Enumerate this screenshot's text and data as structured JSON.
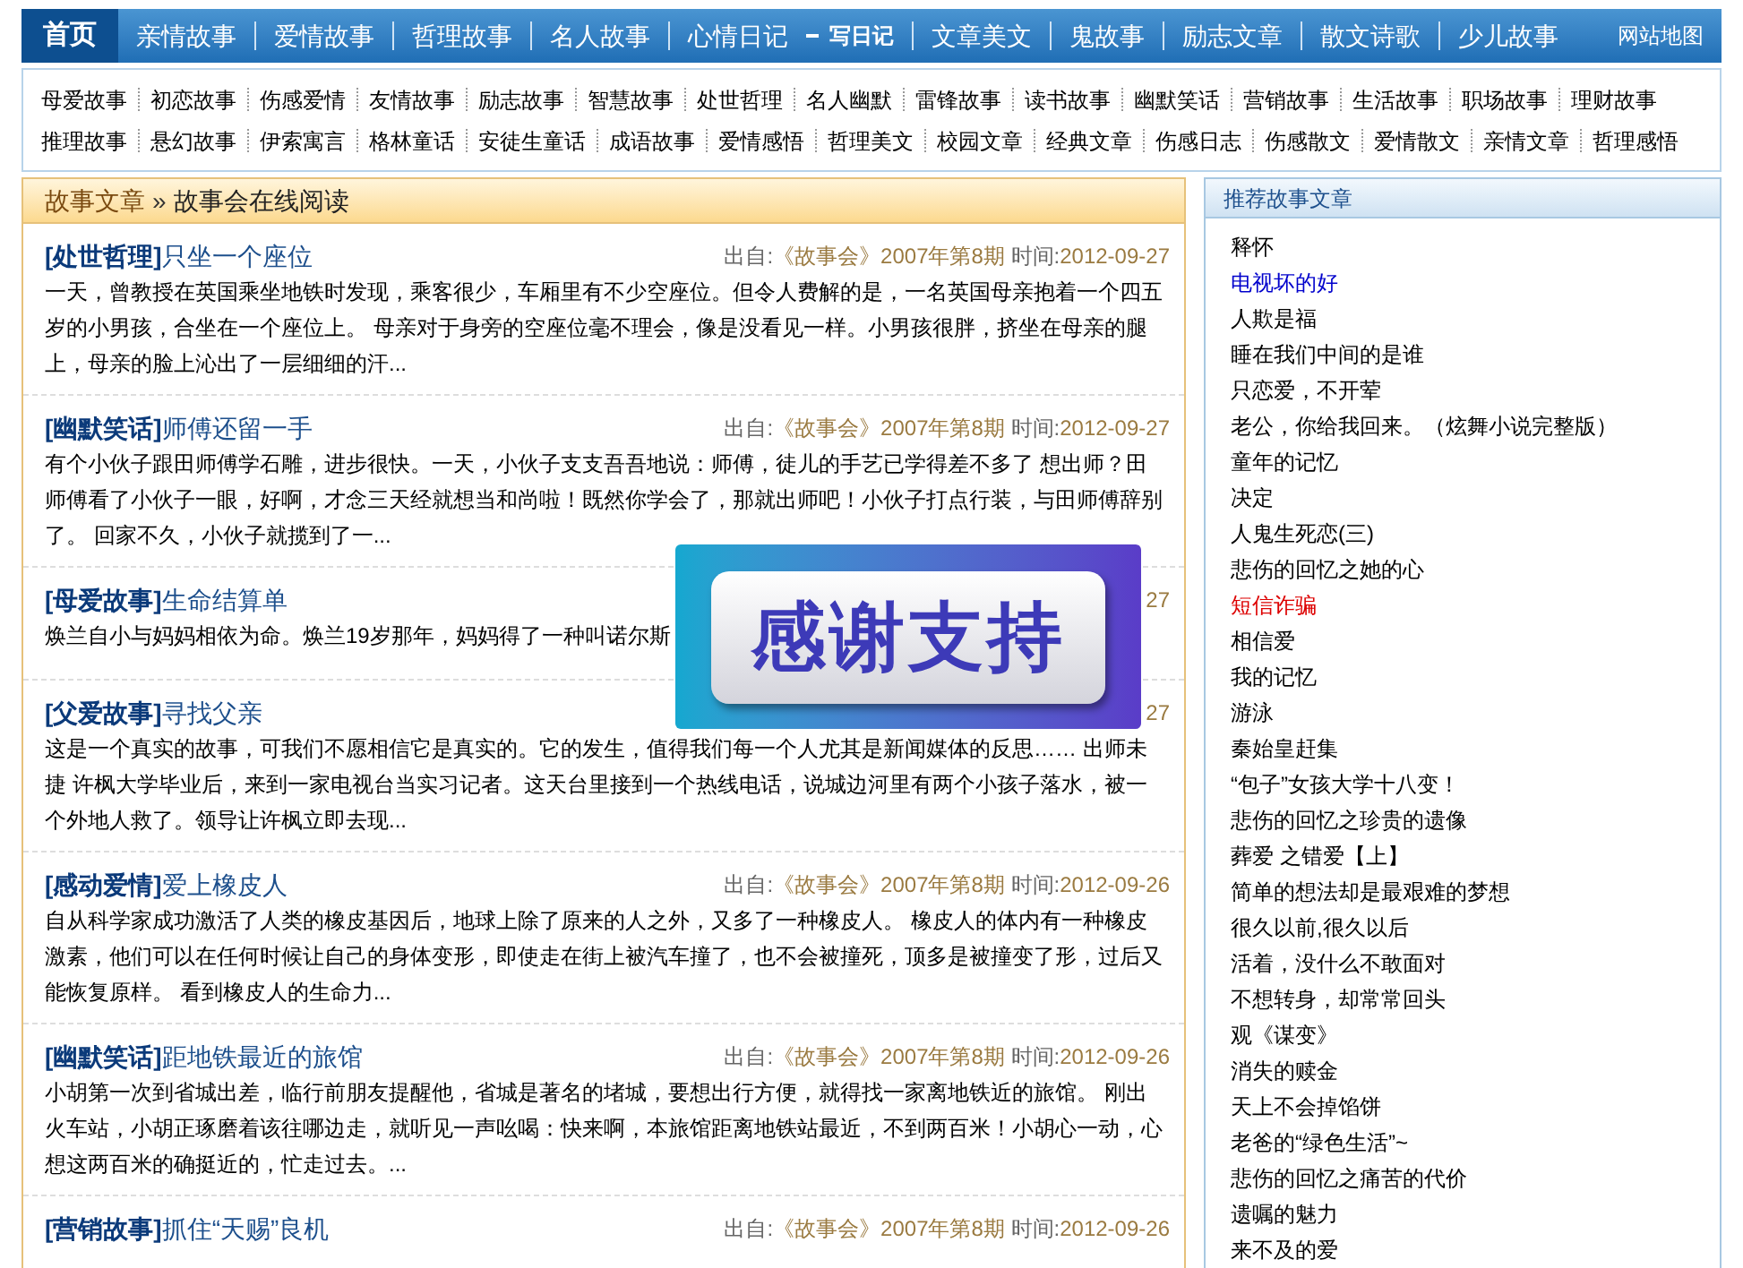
{
  "nav": {
    "items": [
      {
        "label": "首页",
        "selected": true
      },
      {
        "label": "亲情故事",
        "selected": false
      },
      {
        "label": "爱情故事",
        "selected": false
      },
      {
        "label": "哲理故事",
        "selected": false
      },
      {
        "label": "名人故事",
        "selected": false
      },
      {
        "label": "心情日记",
        "selected": false,
        "sub": "写日记"
      },
      {
        "label": "文章美文",
        "selected": false
      },
      {
        "label": "鬼故事",
        "selected": false
      },
      {
        "label": "励志文章",
        "selected": false
      },
      {
        "label": "散文诗歌",
        "selected": false
      },
      {
        "label": "少儿故事",
        "selected": false
      }
    ],
    "sitemap": "网站地图"
  },
  "subnav": [
    [
      "母爱故事",
      "初恋故事",
      "伤感爱情",
      "友情故事",
      "励志故事",
      "智慧故事",
      "处世哲理",
      "名人幽默",
      "雷锋故事",
      "读书故事",
      "幽默笑话",
      "营销故事",
      "生活故事",
      "职场故事",
      "理财故事"
    ],
    [
      "推理故事",
      "悬幻故事",
      "伊索寓言",
      "格林童话",
      "安徒生童话",
      "成语故事",
      "爱情感悟",
      "哲理美文",
      "校园文章",
      "经典文章",
      "伤感日志",
      "伤感散文",
      "爱情散文",
      "亲情文章",
      "哲理感悟"
    ]
  ],
  "breadcrumb": {
    "items": [
      "故事文章",
      "故事会在线阅读"
    ],
    "separator": "»"
  },
  "stories": [
    {
      "kind": "full",
      "category": "[处世哲理]",
      "title": "只坐一个座位",
      "source_label": "出自:",
      "source": "《故事会》2007年第8期",
      "time_label": "时间:",
      "time": "2012-09-27",
      "body": "一天，曾教授在英国乘坐地铁时发现，乘客很少，车厢里有不少空座位。但令人费解的是，一名英国母亲抱着一个四五岁的小男孩，合坐在一个座位上。 母亲对于身旁的空座位毫不理会，像是没看见一样。小男孩很胖，挤坐在母亲的腿上，母亲的脸上沁出了一层细细的汗..."
    },
    {
      "kind": "full",
      "category": "[幽默笑话]",
      "title": "师傅还留一手",
      "source_label": "出自:",
      "source": "《故事会》2007年第8期",
      "time_label": "时间:",
      "time": "2012-09-27",
      "body": "有个小伙子跟田师傅学石雕，进步很快。一天，小伙子支支吾吾地说：师傅，徒儿的手艺已学得差不多了 想出师？田师傅看了小伙子一眼，好啊，才念三天经就想当和尚啦！既然你学会了，那就出师吧！小伙子打点行装，与田师傅辞别了。 回家不久，小伙子就揽到了一..."
    },
    {
      "kind": "partial",
      "category": "[母爱故事]",
      "title": "生命结算单",
      "meta_fragment": "27",
      "body": "焕兰自小与妈妈相依为命。焕兰19岁那年，妈妈得了一种叫诺尔斯"
    },
    {
      "kind": "partial",
      "category": "[父爱故事]",
      "title": "寻找父亲",
      "meta_fragment": "27",
      "body": "这是一个真实的故事，可我们不愿相信它是真实的。它的发生，值得我们每一个人尤其是新闻媒体的反思…… 出师未捷 许枫大学毕业后，来到一家电视台当实习记者。这天台里接到一个热线电话，说城边河里有两个小孩子落水，被一个外地人救了。领导让许枫立即去现..."
    },
    {
      "kind": "full",
      "category": "[感动爱情]",
      "title": "爱上橡皮人",
      "source_label": "出自:",
      "source": "《故事会》2007年第8期",
      "time_label": "时间:",
      "time": "2012-09-26",
      "body": "自从科学家成功激活了人类的橡皮基因后，地球上除了原来的人之外，又多了一种橡皮人。 橡皮人的体内有一种橡皮激素，他们可以在任何时候让自己的身体变形，即使走在街上被汽车撞了，也不会被撞死，顶多是被撞变了形，过后又能恢复原样。 看到橡皮人的生命力..."
    },
    {
      "kind": "full",
      "category": "[幽默笑话]",
      "title": "距地铁最近的旅馆",
      "source_label": "出自:",
      "source": "《故事会》2007年第8期",
      "time_label": "时间:",
      "time": "2012-09-26",
      "body": "小胡第一次到省城出差，临行前朋友提醒他，省城是著名的堵城，要想出行方便，就得找一家离地铁近的旅馆。 刚出火车站，小胡正琢磨着该往哪边走，就听见一声吆喝：快来啊，本旅馆距离地铁站最近，不到两百米！小胡心一动，心想这两百米的确挺近的，忙走过去。..."
    },
    {
      "kind": "full",
      "category": "[营销故事]",
      "title": "抓住“天赐”良机",
      "source_label": "出自:",
      "source": "《故事会》2007年第8期",
      "time_label": "时间:",
      "time": "2012-09-26"
    }
  ],
  "overlay": {
    "text": "感谢支持"
  },
  "sidebar": {
    "title": "推荐故事文章",
    "items": [
      {
        "label": "释怀",
        "color": "#000000"
      },
      {
        "label": "电视坏的好",
        "color": "#0000cc"
      },
      {
        "label": "人欺是福",
        "color": "#000000"
      },
      {
        "label": "睡在我们中间的是谁",
        "color": "#000000"
      },
      {
        "label": "只恋爱，不开荤",
        "color": "#000000"
      },
      {
        "label": "老公，你给我回来。（炫舞小说完整版）",
        "color": "#000000"
      },
      {
        "label": "童年的记忆",
        "color": "#000000"
      },
      {
        "label": "决定",
        "color": "#000000"
      },
      {
        "label": "人鬼生死恋(三)",
        "color": "#000000"
      },
      {
        "label": "悲伤的回忆之她的心",
        "color": "#000000"
      },
      {
        "label": "短信诈骗",
        "color": "#dd0000"
      },
      {
        "label": "相信爱",
        "color": "#000000"
      },
      {
        "label": "我的记忆",
        "color": "#000000"
      },
      {
        "label": "游泳",
        "color": "#000000"
      },
      {
        "label": "秦始皇赶集",
        "color": "#000000"
      },
      {
        "label": "“包子”女孩大学十八变！",
        "color": "#000000"
      },
      {
        "label": "悲伤的回忆之珍贵的遗像",
        "color": "#000000"
      },
      {
        "label": "葬爱 之错爱【上】",
        "color": "#000000"
      },
      {
        "label": "简单的想法却是最艰难的梦想",
        "color": "#000000"
      },
      {
        "label": "很久以前,很久以后",
        "color": "#000000"
      },
      {
        "label": "活着，没什么不敢面对",
        "color": "#000000"
      },
      {
        "label": "不想转身，却常常回头",
        "color": "#000000"
      },
      {
        "label": "观《谋变》",
        "color": "#000000"
      },
      {
        "label": "消失的赎金",
        "color": "#000000"
      },
      {
        "label": "天上不会掉馅饼",
        "color": "#000000"
      },
      {
        "label": "老爸的“绿色生活”~",
        "color": "#000000"
      },
      {
        "label": "悲伤的回忆之痛苦的代价",
        "color": "#000000"
      },
      {
        "label": "遗嘱的魅力",
        "color": "#000000"
      },
      {
        "label": "来不及的爱",
        "color": "#000000"
      }
    ]
  }
}
